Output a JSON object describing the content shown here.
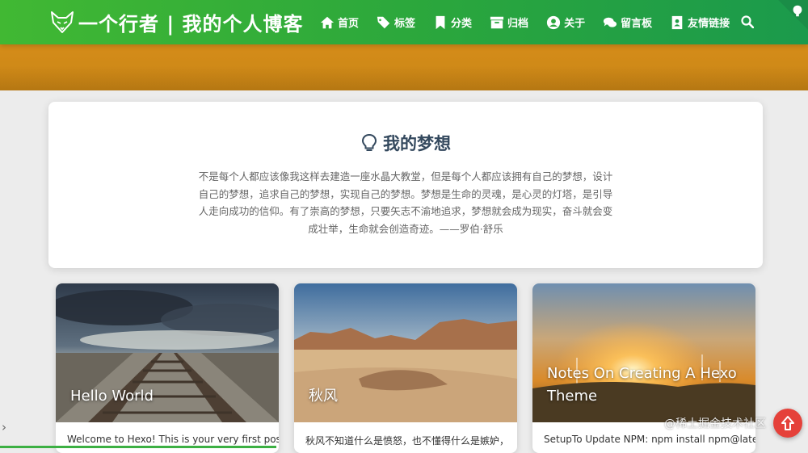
{
  "site": {
    "title": "一个行者 | 我的个人博客"
  },
  "nav": {
    "items": [
      {
        "label": "首页",
        "icon": "home-icon"
      },
      {
        "label": "标签",
        "icon": "tags-icon"
      },
      {
        "label": "分类",
        "icon": "bookmark-icon"
      },
      {
        "label": "归档",
        "icon": "archive-icon"
      },
      {
        "label": "关于",
        "icon": "user-icon"
      },
      {
        "label": "留言板",
        "icon": "comments-icon"
      },
      {
        "label": "友情链接",
        "icon": "address-card-icon"
      }
    ]
  },
  "dream": {
    "title": "我的梦想",
    "text": "不是每个人都应该像我这样去建造一座水晶大教堂，但是每个人都应该拥有自己的梦想，设计自己的梦想，追求自己的梦想，实现自己的梦想。梦想是生命的灵魂，是心灵的灯塔，是引导人走向成功的信仰。有了崇高的梦想，只要矢志不渝地追求，梦想就会成为现实，奋斗就会变成壮举，生命就会创造奇迹。——罗伯·舒乐"
  },
  "posts": [
    {
      "title": "Hello World",
      "excerpt": "Welcome to Hexo! This is your very first post."
    },
    {
      "title": "秋风",
      "excerpt": "秋风不知道什么是愤怒，也不懂得什么是嫉妒，"
    },
    {
      "title": "Notes On Creating A Hexo Theme",
      "excerpt": "SetupTo Update NPM: npm install npm@latest"
    }
  ],
  "watermark": "@稀土掘金技术社区",
  "colors": {
    "header_start": "#41b833",
    "header_end": "#1b9a4c",
    "accent": "#3cb043",
    "back_top": "#e5413a"
  }
}
